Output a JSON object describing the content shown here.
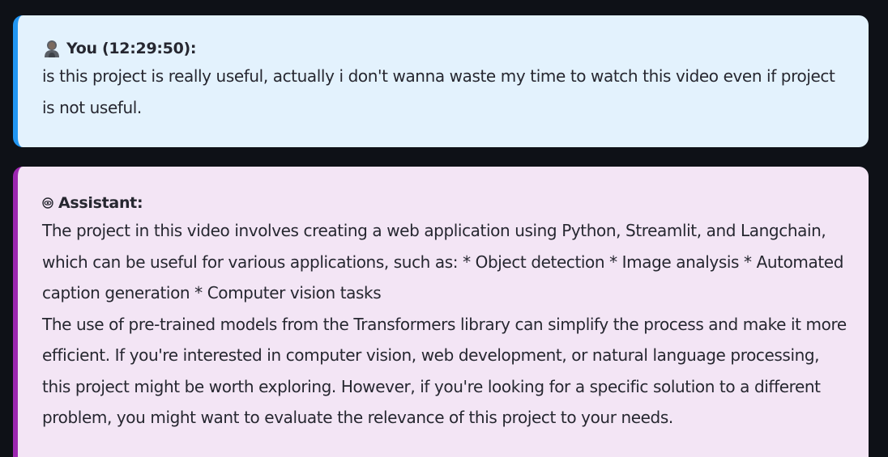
{
  "messages": [
    {
      "role": "user",
      "icon": "user-avatar-icon",
      "header": "You (12:29:50):",
      "text": "is this project is really useful, actually i don't wanna waste my time to watch this video even if project is not useful."
    },
    {
      "role": "assistant",
      "icon": "robot-eye-icon",
      "header": "Assistant:",
      "paragraphs": [
        "The project in this video involves creating a web application using Python, Streamlit, and Langchain, which can be useful for various applications, such as: * Object detection * Image analysis * Automated caption generation * Computer vision tasks",
        "The use of pre-trained models from the Transformers library can simplify the process and make it more efficient. If you're interested in computer vision, web development, or natural language processing, this project might be worth exploring. However, if you're looking for a specific solution to a different problem, you might want to evaluate the relevance of this project to your needs."
      ]
    }
  ],
  "colors": {
    "page_background": "#0e1117",
    "user_background": "#e3f2fd",
    "user_accent": "#2196f3",
    "assistant_background": "#f3e5f5",
    "assistant_accent": "#9c27b0",
    "text": "#262730"
  }
}
